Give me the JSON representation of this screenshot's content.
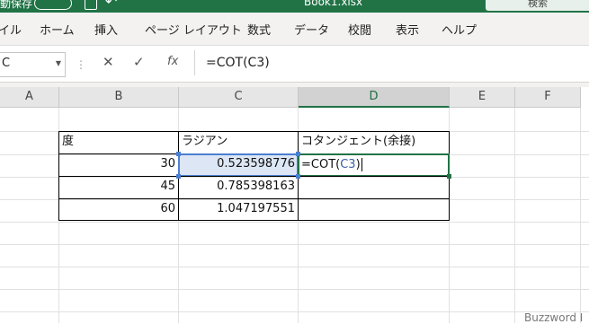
{
  "titlebar": {
    "left_text": "動保存",
    "autosave": "オフ",
    "document": "Book1.xlsx",
    "search_placeholder": "検索",
    "accent": "#217346"
  },
  "ribbon_tabs": [
    "イル",
    "ホーム",
    "挿入",
    "ページ レイアウト",
    "数式",
    "データ",
    "校閲",
    "表示",
    "ヘルプ"
  ],
  "formula_bar": {
    "name_box": "C",
    "cancel_icon": "✕",
    "enter_icon": "✓",
    "function_icon": "fx",
    "formula": "=COT(C3)"
  },
  "columns": [
    "A",
    "B",
    "C",
    "D",
    "E",
    "F"
  ],
  "selected_column": "D",
  "table": {
    "headers": [
      "度",
      "ラジアン",
      "コタンジェント(余接)"
    ],
    "rows": [
      {
        "degrees": "30",
        "radians": "0.523598776",
        "edit_prefix": "=COT(",
        "edit_ref": "C3",
        "edit_suffix": ")"
      },
      {
        "degrees": "45",
        "radians": "0.785398163",
        "cot": ""
      },
      {
        "degrees": "60",
        "radians": "1.047197551",
        "cot": ""
      }
    ]
  },
  "watermark": "Buzzword I"
}
